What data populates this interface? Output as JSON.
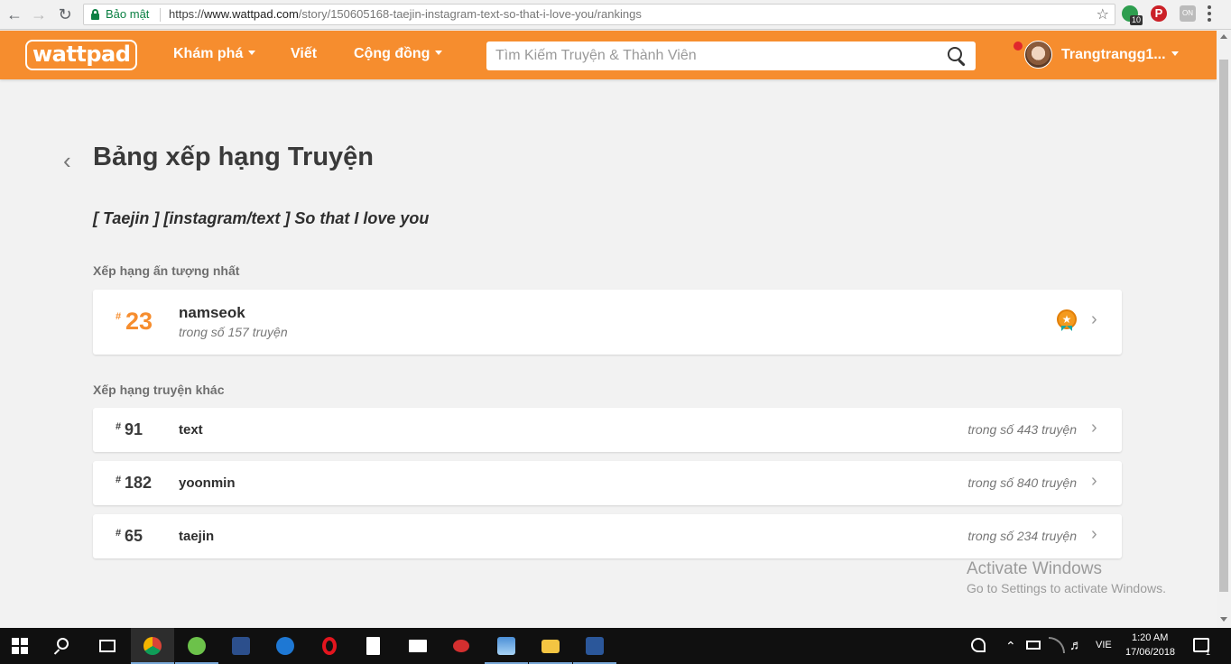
{
  "browser": {
    "secure_label": "Bảo mật",
    "url_scheme": "https://",
    "url_host": "www.wattpad.com",
    "url_path": "/story/150605168-taejin-instagram-text-so-that-i-love-you/rankings",
    "extension_badge": "10",
    "ext_pin_glyph": "P",
    "ext_on_glyph": "ON"
  },
  "header": {
    "logo": "wattpad",
    "nav": [
      "Khám phá",
      "Viết",
      "Cộng đồng"
    ],
    "search_placeholder": "Tìm Kiếm Truyện & Thành Viên",
    "username": "Trangtrangg1...",
    "brand_color": "#f68d2e"
  },
  "page": {
    "title": "Bảng xếp hạng Truyện",
    "story_title": "[ Taejin ] [instagram/text ] So that I love you",
    "featured_label": "Xếp hạng ấn tượng nhất",
    "featured": {
      "hash": "#",
      "rank": "23",
      "tag": "namseok",
      "of": "trong số 157 truyện",
      "badge_icon": "medal-star-icon"
    },
    "other_label": "Xếp hạng truyện khác",
    "others": [
      {
        "hash": "#",
        "rank": "91",
        "tag": "text",
        "of": "trong số 443 truyện"
      },
      {
        "hash": "#",
        "rank": "182",
        "tag": "yoonmin",
        "of": "trong số 840 truyện"
      },
      {
        "hash": "#",
        "rank": "65",
        "tag": "taejin",
        "of": "trong số 234 truyện"
      }
    ]
  },
  "watermark": {
    "line1": "Activate Windows",
    "line2": "Go to Settings to activate Windows."
  },
  "taskbar": {
    "language": "VIE",
    "time": "1:20 AM",
    "date": "17/06/2018",
    "notification_count": "1"
  }
}
